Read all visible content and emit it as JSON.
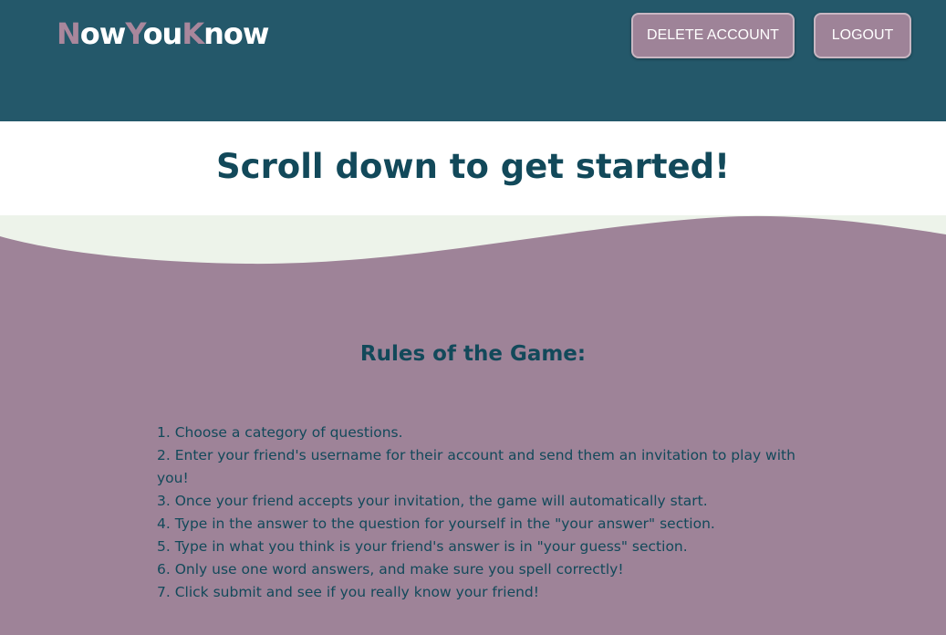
{
  "header": {
    "logo": {
      "parts": [
        "N",
        "ow",
        "Y",
        "ou",
        "K",
        "now"
      ]
    },
    "buttons": {
      "delete_account": "DELETE ACCOUNT",
      "logout": "LOGOUT"
    }
  },
  "banner": {
    "title": "Scroll down to get started!"
  },
  "rules": {
    "title": "Rules of the Game:",
    "items": [
      "1. Choose a category of questions.",
      "2. Enter your friend's username for their account and send them an invitation to play with you!",
      "3. Once your friend accepts your invitation, the game will automatically start.",
      "4. Type in the answer to the question for yourself in the \"your answer\" section.",
      "5. Type in what you think is your friend's answer is in \"your guess\" section.",
      "6. Only use one word answers, and make sure you spell correctly!",
      "7. Click submit and see if you really know your friend!"
    ]
  },
  "colors": {
    "header_bg": "#24586a",
    "accent_mauve": "#9e8398",
    "title_teal": "#12495a",
    "wave_light": "#edf3ea"
  }
}
